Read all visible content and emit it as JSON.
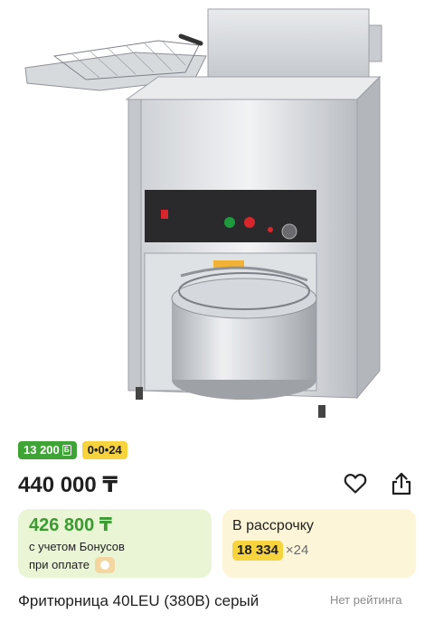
{
  "product": {
    "image_alt": "",
    "title": "Фритюрница 40LEU (380В) серый",
    "rating_text": "Нет рейтинга"
  },
  "badges": {
    "bonus": "13 200",
    "bonus_icon": "bonus-coin-icon",
    "installment": "0•0•24"
  },
  "price": {
    "current": "440 000 ₸"
  },
  "actions": {
    "favorite_icon": "heart-icon",
    "share_icon": "share-icon"
  },
  "bonus_card": {
    "price": "426 800 ₸",
    "line1": "с учетом Бонусов",
    "line2": "при оплате"
  },
  "installment_card": {
    "title": "В рассрочку",
    "amount": "18 334",
    "months": "×24"
  },
  "colors": {
    "bonus_green": "#3fa436",
    "installment_yellow": "#f7d33e",
    "bonus_card_bg": "#eaf5d6",
    "installment_card_bg": "#fdf5d7"
  }
}
